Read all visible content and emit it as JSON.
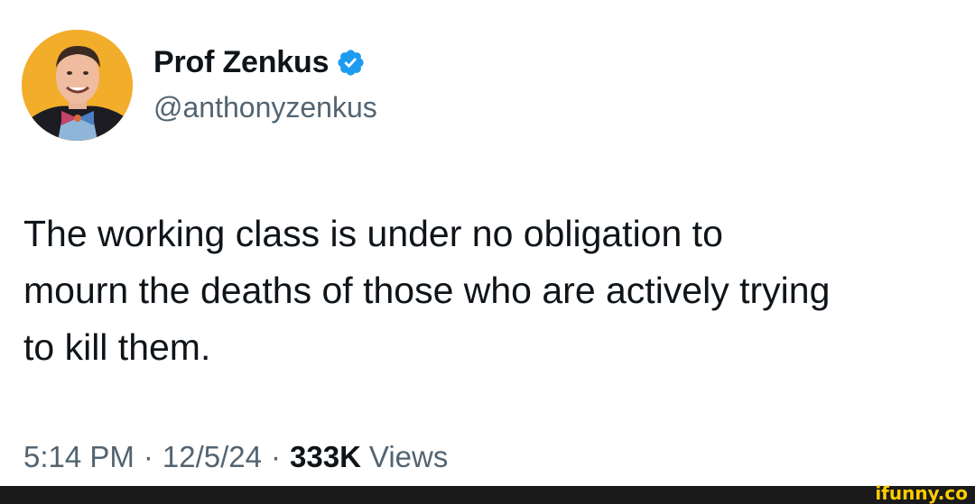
{
  "author": {
    "display_name": "Prof Zenkus",
    "handle": "@anthonyzenkus",
    "verified_icon": "verified-badge-icon",
    "badge_color": "#1d9bf0"
  },
  "tweet": {
    "text": "The working class is under no obligation to\nmourn the deaths of those who are actively trying\nto kill them."
  },
  "meta": {
    "time": "5:14 PM",
    "separator": "·",
    "date": "12/5/24",
    "views_count": "333K",
    "views_label": "Views"
  },
  "watermark": {
    "text": "ifunny.co",
    "color": "#ffcc00"
  }
}
